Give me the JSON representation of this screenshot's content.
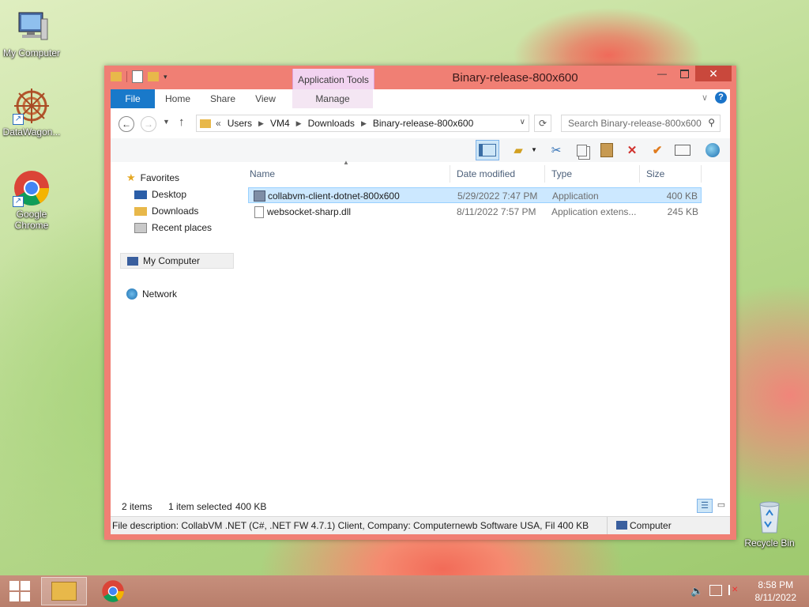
{
  "desktop": {
    "icons": [
      {
        "label": "My Computer"
      },
      {
        "label": "DataWagon..."
      },
      {
        "label": "Google Chrome"
      },
      {
        "label": "Recycle Bin"
      }
    ]
  },
  "window": {
    "title": "Binary-release-800x600",
    "context_tab_group": "Application Tools",
    "ribbon_tabs": [
      "File",
      "Home",
      "Share",
      "View",
      "Manage"
    ],
    "address": {
      "overflow": "«",
      "segments": [
        "Users",
        "VM4",
        "Downloads",
        "Binary-release-800x600"
      ]
    },
    "search_placeholder": "Search Binary-release-800x600",
    "nav_pane": {
      "favorites": "Favorites",
      "desktop": "Desktop",
      "downloads": "Downloads",
      "recent": "Recent places",
      "my_computer": "My Computer",
      "network": "Network"
    },
    "columns": [
      "Name",
      "Date modified",
      "Type",
      "Size"
    ],
    "files": [
      {
        "name": "collabvm-client-dotnet-800x600",
        "date": "5/29/2022 7:47 PM",
        "type": "Application",
        "size": "400 KB"
      },
      {
        "name": "websocket-sharp.dll",
        "date": "8/11/2022 7:57 PM",
        "type": "Application extens...",
        "size": "245 KB"
      }
    ],
    "status": {
      "items": "2 items",
      "selected": "1 item selected",
      "size": "400 KB"
    },
    "details": {
      "description": "File description: CollabVM .NET (C#, .NET FW 4.7.1) Client, Company: Computernewb Software USA, Fil 400 KB",
      "location": "Computer"
    }
  },
  "taskbar": {
    "time": "8:58 PM",
    "date": "8/11/2022"
  },
  "colors": {
    "window_frame": "#f07f74",
    "file_tab": "#1979ca",
    "selection": "#cce8ff",
    "close_button": "#c9483c"
  }
}
